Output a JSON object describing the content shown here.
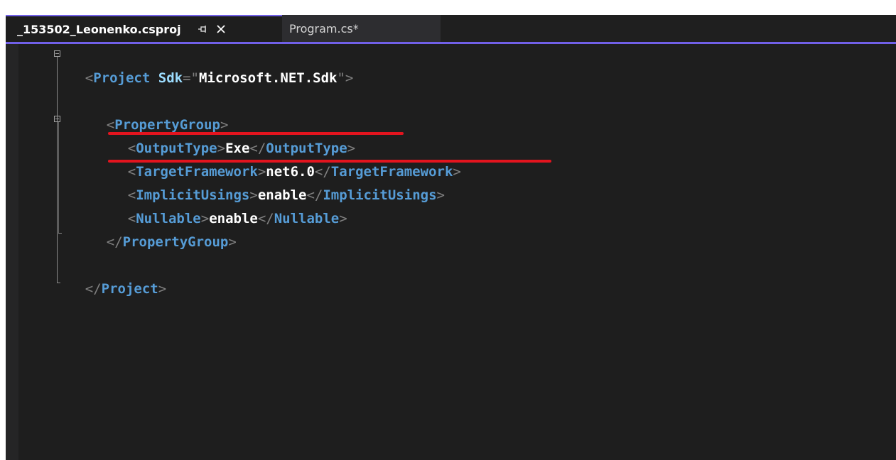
{
  "tabs": [
    {
      "label": "_153502_Leonenko.csproj",
      "active": true,
      "pin_icon": "pin-icon",
      "close_icon": "close-icon"
    },
    {
      "label": "Program.cs*",
      "active": false
    }
  ],
  "colors": {
    "accent": "#7160e8",
    "editor_bg": "#1e1e1e",
    "tag": "#569cd6",
    "attribute": "#9cdcfe",
    "string": "#ce9178",
    "punctuation": "#808080",
    "text": "#ffffff",
    "annotation_underline": "#e3141e"
  },
  "code": {
    "line1": {
      "open": "<",
      "tag": "Project",
      "attr": "Sdk",
      "eq": "=",
      "q1": "\"",
      "value": "Microsoft.NET.Sdk",
      "q2": "\"",
      "close": ">"
    },
    "line3": {
      "open": "<",
      "tag": "PropertyGroup",
      "close": ">"
    },
    "line4": {
      "open": "<",
      "tag": "OutputType",
      "close": ">",
      "value": "Exe",
      "end_open": "</",
      "end_tag": "OutputType",
      "end_close": ">"
    },
    "line5": {
      "open": "<",
      "tag": "TargetFramework",
      "close": ">",
      "value": "net6.0",
      "end_open": "</",
      "end_tag": "TargetFramework",
      "end_close": ">"
    },
    "line6": {
      "open": "<",
      "tag": "ImplicitUsings",
      "close": ">",
      "value": "enable",
      "end_open": "</",
      "end_tag": "ImplicitUsings",
      "end_close": ">"
    },
    "line7": {
      "open": "<",
      "tag": "Nullable",
      "close": ">",
      "value": "enable",
      "end_open": "</",
      "end_tag": "Nullable",
      "end_close": ">"
    },
    "line8": {
      "open": "</",
      "tag": "PropertyGroup",
      "close": ">"
    },
    "line10": {
      "open": "</",
      "tag": "Project",
      "close": ">"
    }
  }
}
